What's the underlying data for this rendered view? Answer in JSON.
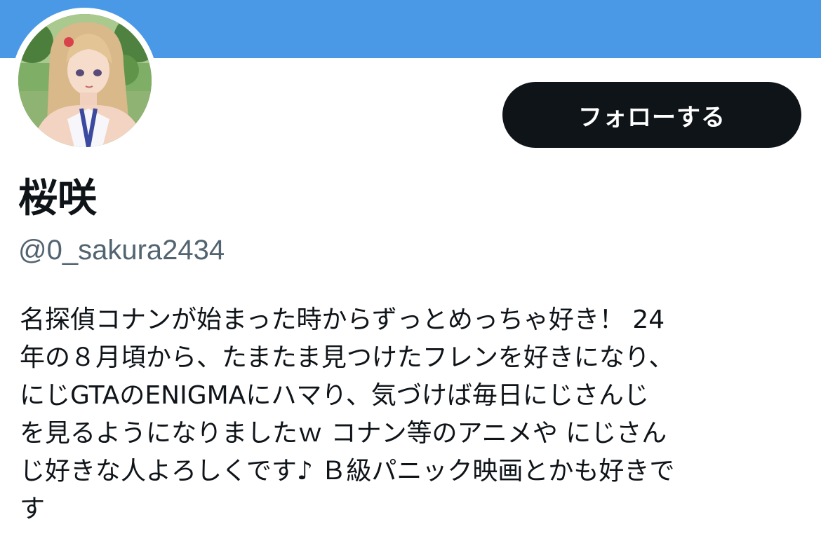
{
  "header": {
    "banner_color": "#4a99e6"
  },
  "profile": {
    "avatar_icon": "profile-avatar",
    "display_name": "桜咲",
    "handle": "@0_sakura2434",
    "bio_lines": [
      "名探偵コナンが始まった時からずっとめっちゃ好き！ 24",
      "年の８月頃から、たまたま見つけたフレンを好きになり、",
      "にじGTAのENIGMAにハマり、気づけば毎日にじさんじ",
      "を見るようになりましたｗ コナン等のアニメや にじさん",
      "じ好きな人よろしくです♪ Ｂ級パニック映画とかも好きで",
      "す"
    ]
  },
  "actions": {
    "follow_label": "フォローする"
  },
  "colors": {
    "primary_text": "#0f1419",
    "secondary_text": "#536471",
    "button_bg": "#0f1419",
    "button_text": "#ffffff"
  }
}
